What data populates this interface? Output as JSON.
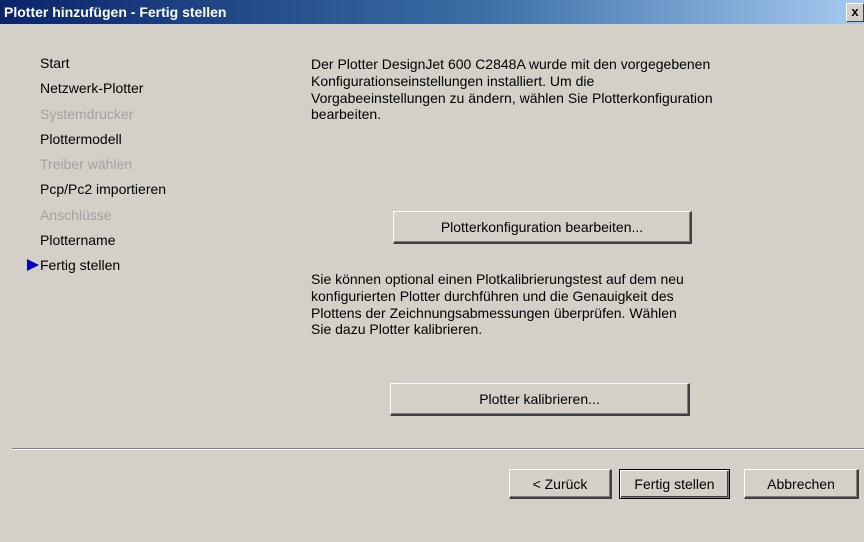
{
  "window": {
    "title": "Plotter hinzufügen - Fertig stellen",
    "close_glyph": "x"
  },
  "steps": [
    {
      "label": "Start",
      "state": "enabled"
    },
    {
      "label": "Netzwerk-Plotter",
      "state": "enabled"
    },
    {
      "label": "Systemdrucker",
      "state": "disabled"
    },
    {
      "label": "Plottermodell",
      "state": "enabled"
    },
    {
      "label": "Treiber wählen",
      "state": "disabled"
    },
    {
      "label": "Pcp/Pc2 importieren",
      "state": "enabled"
    },
    {
      "label": "Anschlüsse",
      "state": "disabled"
    },
    {
      "label": "Plottername",
      "state": "enabled"
    },
    {
      "label": "Fertig stellen",
      "state": "current"
    }
  ],
  "main": {
    "description1": [
      "Der Plotter DesignJet 600 C2848A wurde mit den vorgegebenen",
      "Konfigurationseinstellungen installiert. Um die",
      "Vorgabeeinstellungen zu ändern, wählen Sie Plotterkonfiguration",
      "bearbeiten."
    ],
    "config_button_label": "Plotterkonfiguration bearbeiten...",
    "description2": [
      "Sie können optional einen Plotkalibrierungstest auf dem neu",
      "konfigurierten Plotter durchführen und die Genauigkeit des",
      "Plottens der Zeichnungsabmessungen überprüfen. Wählen",
      "Sie dazu Plotter kalibrieren."
    ],
    "calibrate_button_label": "Plotter kalibrieren..."
  },
  "footer": {
    "back_label": "< Zurück",
    "finish_label": "Fertig stellen",
    "cancel_label": "Abbrechen"
  },
  "colors": {
    "title_bar_start": "#0a246a",
    "title_bar_end": "#a6caf0",
    "dialog_bg": "#d4d0c8",
    "current_step_arrow": "#0000c0",
    "disabled_text": "#a0a0a0"
  },
  "icons": {
    "current_step": "triangle-right-icon",
    "close": "close-icon"
  }
}
